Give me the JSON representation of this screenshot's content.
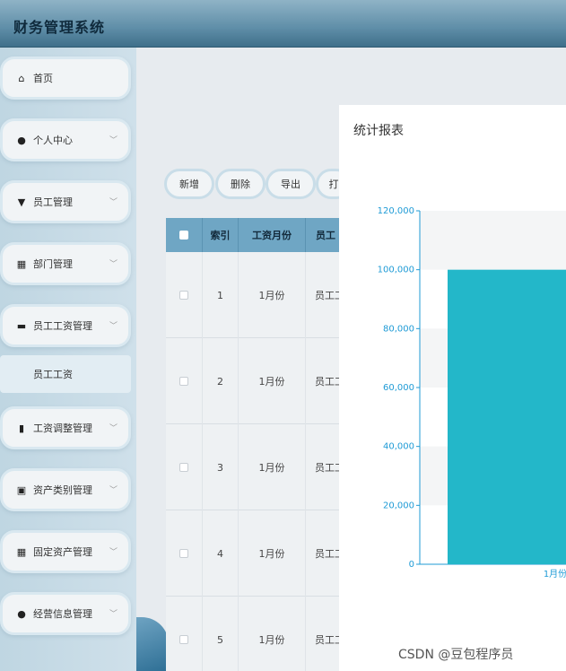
{
  "header": {
    "title": "财务管理系统"
  },
  "sidebar": {
    "items": [
      {
        "label": "首页",
        "icon": "home-icon",
        "glyph": "⌂",
        "has_chevron": false
      },
      {
        "label": "个人中心",
        "icon": "user-icon",
        "glyph": "●",
        "has_chevron": true
      },
      {
        "label": "员工管理",
        "icon": "employee-icon",
        "glyph": "▼",
        "has_chevron": true
      },
      {
        "label": "部门管理",
        "icon": "grid-icon",
        "glyph": "▦",
        "has_chevron": true
      },
      {
        "label": "员工工资管理",
        "icon": "briefcase-icon",
        "glyph": "▬",
        "has_chevron": true
      },
      {
        "label": "工资调整管理",
        "icon": "bar-chart-icon",
        "glyph": "▮",
        "has_chevron": true
      },
      {
        "label": "资产类别管理",
        "icon": "clipboard-icon",
        "glyph": "▣",
        "has_chevron": true
      },
      {
        "label": "固定资产管理",
        "icon": "grid-icon",
        "glyph": "▦",
        "has_chevron": true
      },
      {
        "label": "经营信息管理",
        "icon": "bulb-icon",
        "glyph": "●",
        "has_chevron": true
      }
    ],
    "submenu": {
      "label": "员工工资"
    }
  },
  "toolbar": {
    "add": "新增",
    "delete": "删除",
    "export": "导出",
    "print": "打"
  },
  "table": {
    "headers": {
      "index": "索引",
      "month": "工资月份",
      "employee": "员工"
    },
    "rows": [
      {
        "index": "1",
        "month": "1月份",
        "employee": "员工工"
      },
      {
        "index": "2",
        "month": "1月份",
        "employee": "员工工"
      },
      {
        "index": "3",
        "month": "1月份",
        "employee": "员工工"
      },
      {
        "index": "4",
        "month": "1月份",
        "employee": "员工工"
      },
      {
        "index": "5",
        "month": "1月份",
        "employee": "员工工"
      }
    ]
  },
  "dialog": {
    "title": "统计报表"
  },
  "chart_data": {
    "type": "bar",
    "categories": [
      "1月份"
    ],
    "values": [
      100000
    ],
    "ylim": [
      0,
      120000
    ],
    "yticks": [
      "0",
      "20,000",
      "40,000",
      "60,000",
      "80,000",
      "100,000",
      "120,000"
    ],
    "bar_color": "#23b7c9",
    "axis_color": "#1f9bd6",
    "grid": "banded"
  },
  "watermark": "CSDN @豆包程序员"
}
